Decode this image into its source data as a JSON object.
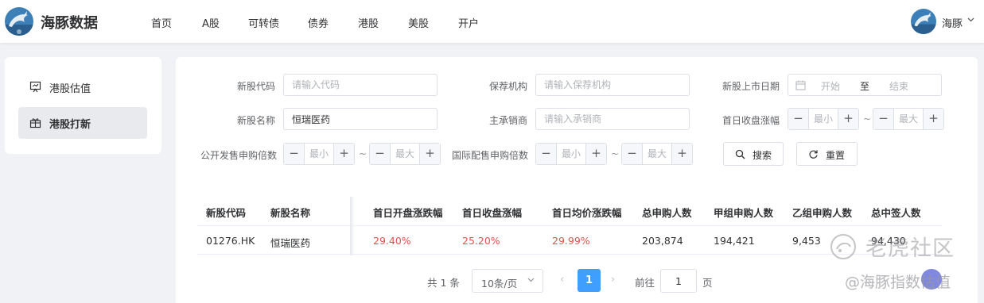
{
  "header": {
    "brand": "海豚数据",
    "nav": [
      "首页",
      "A股",
      "可转债",
      "债券",
      "港股",
      "美股",
      "开户"
    ],
    "user": "海豚"
  },
  "sidebar": {
    "items": [
      {
        "label": "港股估值",
        "icon": "chart-board-icon"
      },
      {
        "label": "港股打新",
        "icon": "gift-icon",
        "active": true
      }
    ]
  },
  "filters": {
    "code": {
      "label": "新股代码",
      "placeholder": "请输入代码"
    },
    "sponsor": {
      "label": "保荐机构",
      "placeholder": "请输入保荐机构"
    },
    "listing_date": {
      "label": "新股上市日期",
      "start": "开始",
      "separator": "至",
      "end": "结束"
    },
    "name": {
      "label": "新股名称",
      "value": "恒瑞医药"
    },
    "underwriter": {
      "label": "主承销商",
      "placeholder": "请输入承销商"
    },
    "first_close_change": {
      "label": "首日收盘涨幅",
      "min": "最小",
      "max": "最大"
    },
    "public_oversub": {
      "label": "公开发售申购倍数",
      "min": "最小",
      "max": "最大"
    },
    "intl_oversub": {
      "label": "国际配售申购倍数",
      "min": "最小",
      "max": "最大"
    },
    "tilde": "~",
    "minus": "−",
    "plus": "+",
    "search_label": "搜索",
    "reset_label": "重置"
  },
  "table": {
    "columns": [
      "新股代码",
      "新股名称",
      "首日开盘涨跌幅",
      "首日收盘涨幅",
      "首日均价涨跌幅",
      "总申购人数",
      "甲组申购人数",
      "乙组申购人数",
      "总中签人数"
    ],
    "rows": [
      [
        "01276.HK",
        "恒瑞医药",
        "29.40%",
        "25.20%",
        "29.99%",
        "203,874",
        "194,421",
        "9,453",
        "94,430"
      ]
    ]
  },
  "pagination": {
    "total": "共 1 条",
    "page_size": "10条/页",
    "prev": "‹",
    "current": "1",
    "next": "›",
    "goto_label": "前往",
    "goto_value": "1",
    "page_unit": "页"
  },
  "watermark": {
    "line1": "老虎社区",
    "line2": "@海豚指数估值"
  },
  "colors": {
    "accent": "#409eff",
    "positive": "#e4514a"
  }
}
